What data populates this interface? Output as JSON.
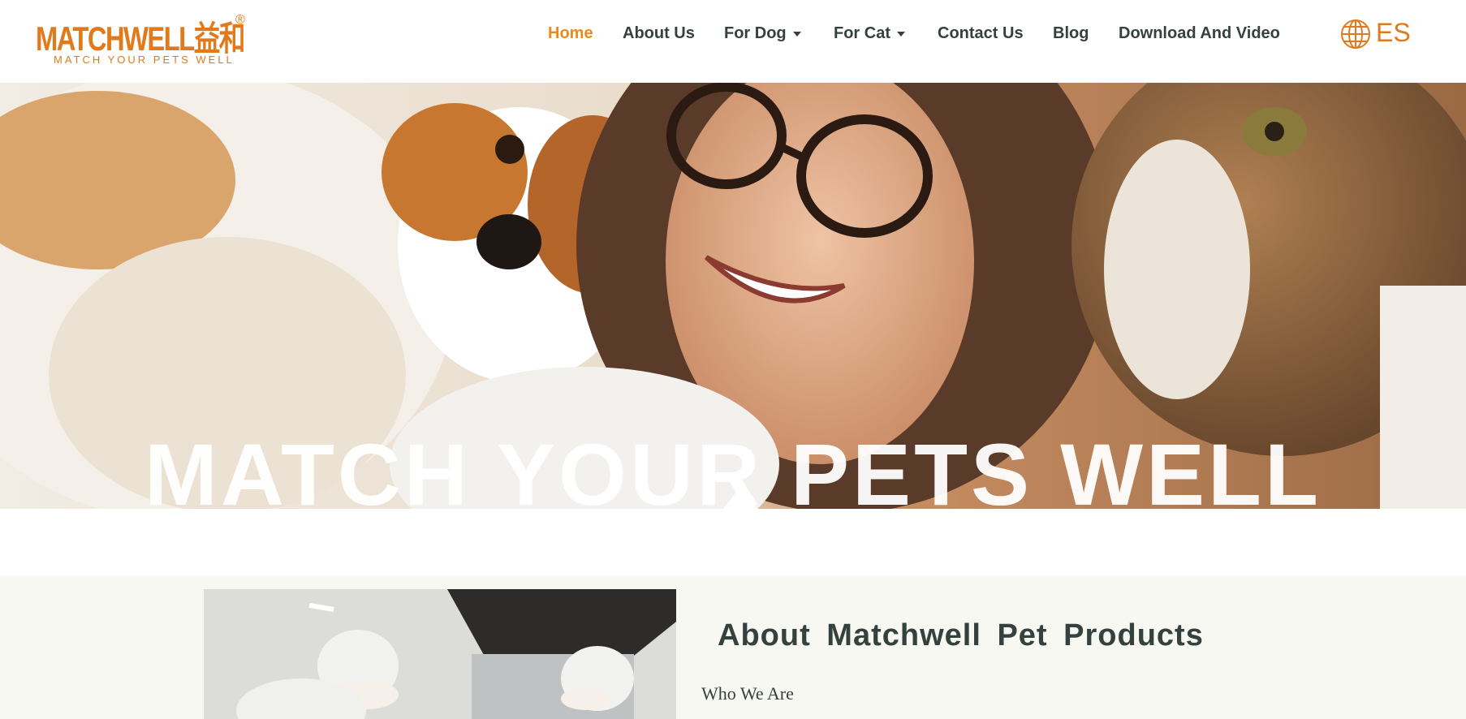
{
  "brand": {
    "name": "MATCHWELL益和",
    "registered_mark": "®",
    "tagline": "MATCH YOUR PETS WELL",
    "color": "#e07a1c"
  },
  "nav": {
    "items": [
      {
        "label": "Home",
        "active": true,
        "has_dropdown": false
      },
      {
        "label": "About Us",
        "active": false,
        "has_dropdown": false
      },
      {
        "label": "For Dog",
        "active": false,
        "has_dropdown": true
      },
      {
        "label": "For Cat",
        "active": false,
        "has_dropdown": true
      },
      {
        "label": "Contact Us",
        "active": false,
        "has_dropdown": false
      },
      {
        "label": "Blog",
        "active": false,
        "has_dropdown": false
      },
      {
        "label": "Download And Video",
        "active": false,
        "has_dropdown": false
      }
    ],
    "active_color": "#e98a1f",
    "text_color": "#34413f"
  },
  "language": {
    "icon": "globe-icon",
    "label": "ES"
  },
  "hero": {
    "headline": "MATCH YOUR PETS WELL"
  },
  "about": {
    "title": "About Matchwell Pet Products",
    "subtitle": "Who We Are"
  }
}
